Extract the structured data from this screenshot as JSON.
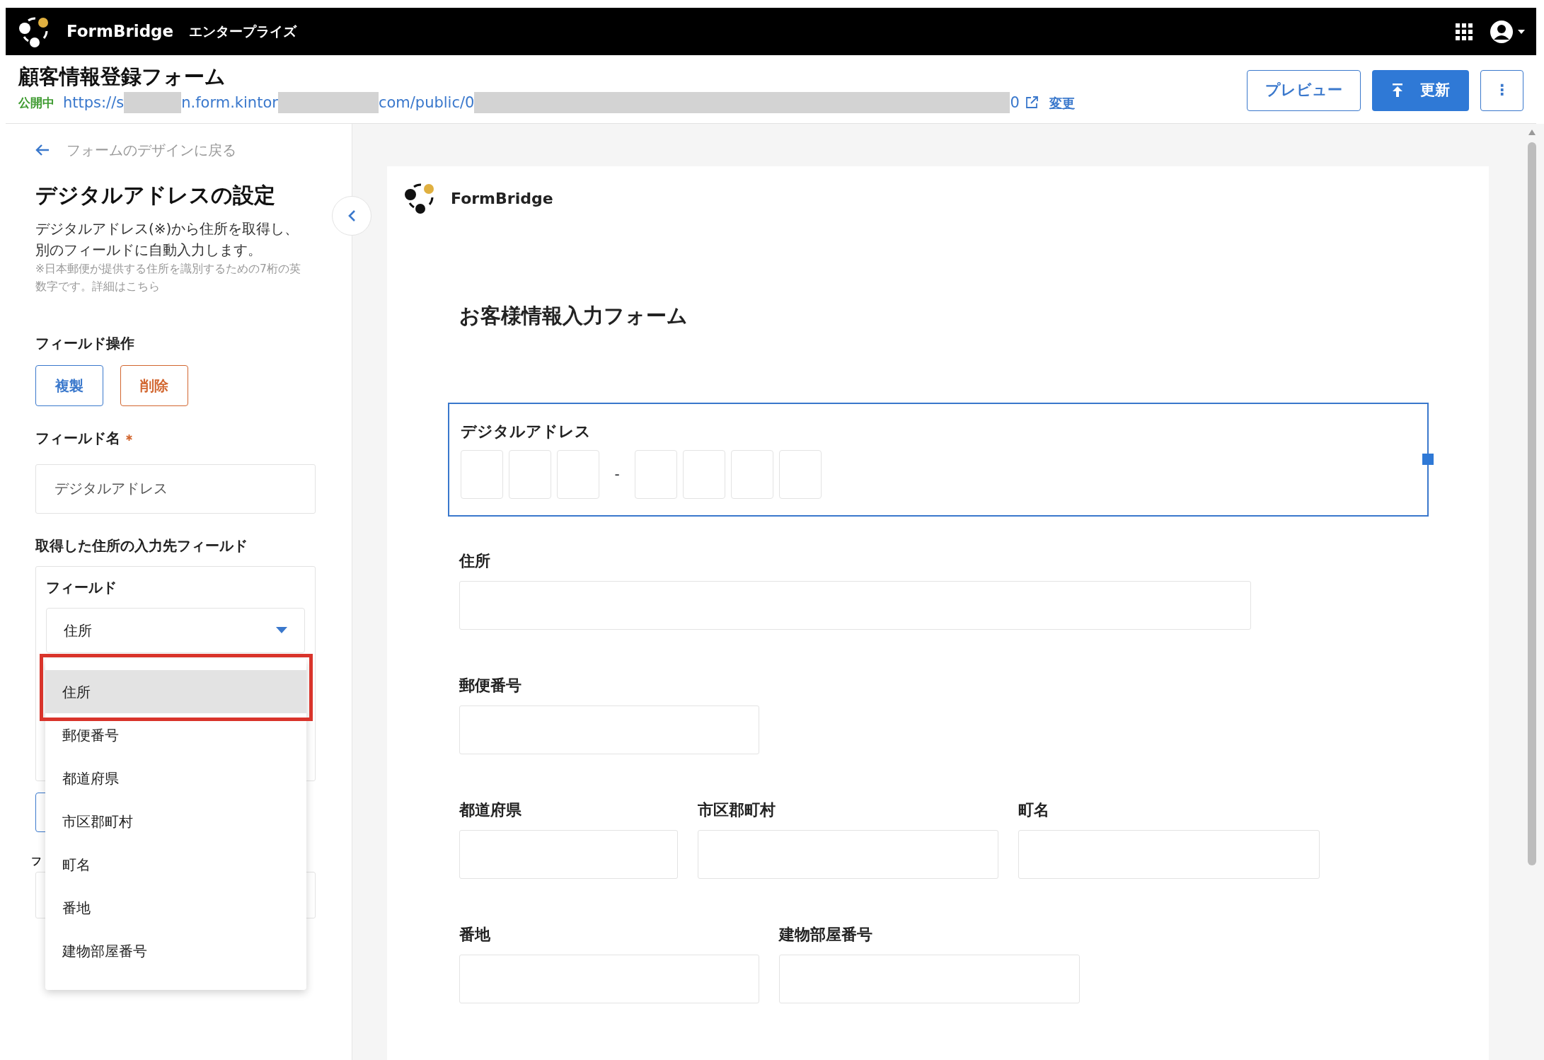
{
  "app_bar": {
    "brand": "FormBridge",
    "edition": "エンタープライズ"
  },
  "form_header": {
    "title": "顧客情報登録フォーム",
    "status": "公開中",
    "url_parts": [
      {
        "kind": "text",
        "text": "https://s"
      },
      {
        "kind": "redacted"
      },
      {
        "kind": "text",
        "text": "n.form.kintor"
      },
      {
        "kind": "redacted"
      },
      {
        "kind": "text",
        "text": "com/public/0"
      },
      {
        "kind": "redacted"
      },
      {
        "kind": "text",
        "text": "0"
      }
    ],
    "change_link": "変更",
    "buttons": [
      {
        "kind": "outline",
        "label": "プレビュー"
      },
      {
        "kind": "primary",
        "label": "更新"
      },
      {
        "kind": "more",
        "label": "⋮"
      }
    ]
  },
  "sidebar": {
    "back_link": "フォームのデザインに戻る",
    "heading": "デジタルアドレスの設定",
    "description": "デジタルアドレス(※)から住所を取得し、別のフィールドに自動入力します。",
    "note": "※日本郵便が提供する住所を識別するための7桁の英数字です。",
    "note_link": "詳細はこちら",
    "field_ops": {
      "label": "フィールド操作",
      "buttons": [
        {
          "kind": "copy",
          "label": "複製"
        },
        {
          "kind": "delete",
          "label": "削除"
        }
      ]
    },
    "field_name": {
      "label": "フィールド名",
      "required": true,
      "value": "デジタルアドレス"
    },
    "target": {
      "label": "取得した住所の入力先フィールド",
      "field_label": "フィールド",
      "select_value": "住所",
      "options": [
        {
          "label": "住所",
          "selected": true
        },
        {
          "label": "郵便番号",
          "selected": false
        },
        {
          "label": "都道府県",
          "selected": false
        },
        {
          "label": "市区郡町村",
          "selected": false
        },
        {
          "label": "町名",
          "selected": false
        },
        {
          "label": "番地",
          "selected": false
        },
        {
          "label": "建物部屋番号",
          "selected": false
        }
      ]
    },
    "hidden_label": "フ"
  },
  "preview": {
    "brand": "FormBridge",
    "title": "お客様情報入力フォーム",
    "digital_address": {
      "label": "デジタルアドレス",
      "selected": true,
      "separator": "-"
    },
    "rows": [
      [
        {
          "label": "住所"
        }
      ],
      [
        {
          "label": "郵便番号"
        }
      ],
      [
        {
          "label": "都道府県"
        },
        {
          "label": "市区郡町村"
        },
        {
          "label": "町名"
        }
      ],
      [
        {
          "label": "番地"
        },
        {
          "label": "建物部屋番号"
        }
      ]
    ]
  }
}
